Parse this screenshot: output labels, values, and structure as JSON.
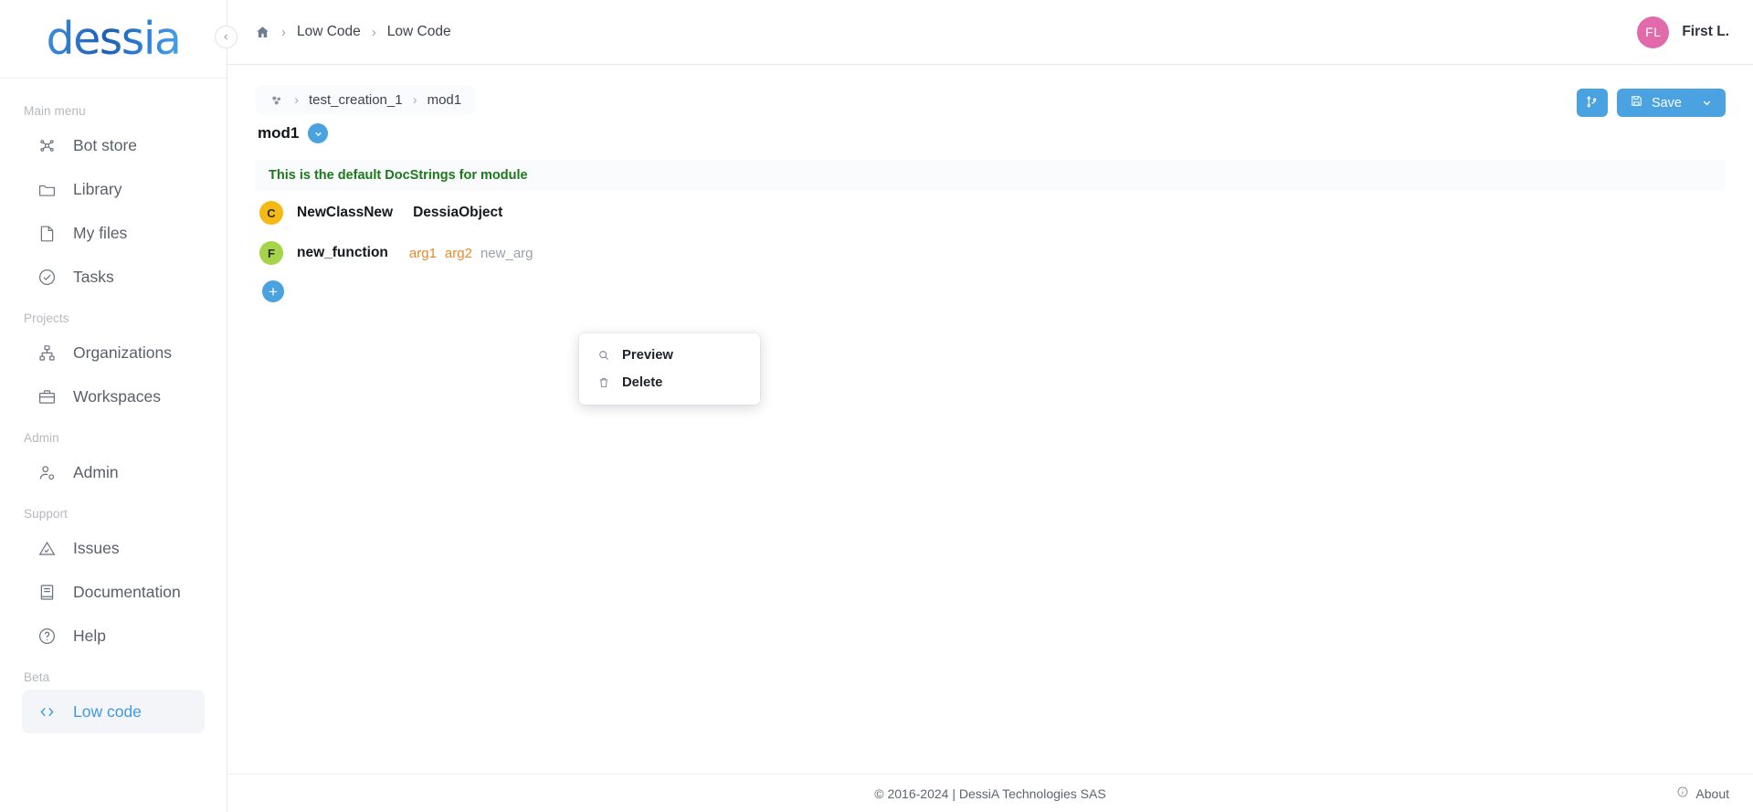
{
  "brand": {
    "logo_text": "dessia"
  },
  "sidebar": {
    "sections": [
      {
        "label": "Main menu",
        "items": [
          {
            "label": "Bot store",
            "icon": "bot-store-icon"
          },
          {
            "label": "Library",
            "icon": "folder-icon"
          },
          {
            "label": "My files",
            "icon": "file-icon"
          },
          {
            "label": "Tasks",
            "icon": "check-circle-icon"
          }
        ]
      },
      {
        "label": "Projects",
        "items": [
          {
            "label": "Organizations",
            "icon": "org-chart-icon"
          },
          {
            "label": "Workspaces",
            "icon": "briefcase-icon"
          }
        ]
      },
      {
        "label": "Admin",
        "items": [
          {
            "label": "Admin",
            "icon": "user-cog-icon"
          }
        ]
      },
      {
        "label": "Support",
        "items": [
          {
            "label": "Issues",
            "icon": "alert-triangle-icon"
          },
          {
            "label": "Documentation",
            "icon": "book-icon"
          },
          {
            "label": "Help",
            "icon": "question-circle-icon"
          }
        ]
      },
      {
        "label": "Beta",
        "items": [
          {
            "label": "Low code",
            "icon": "code-brackets-icon",
            "active": true
          }
        ]
      }
    ]
  },
  "topbar": {
    "home_icon": "home-icon",
    "breadcrumbs": [
      "Low Code",
      "Low Code"
    ],
    "separator": "›",
    "user": {
      "initials": "FL",
      "name": "First L.",
      "avatar_color": "#e06aaa"
    },
    "collapse_icon": "chevron-left-icon"
  },
  "module": {
    "mini_breadcrumbs": [
      "test_creation_1",
      "mod1"
    ],
    "cube_icon": "cube-icon",
    "title": "mod1",
    "expand_icon": "chevron-down-icon",
    "docstring": "This is the default DocStrings for module",
    "members": [
      {
        "badge": "C",
        "badge_kind": "cls",
        "name": "NewClassNew",
        "base": "DessiaObject",
        "args": []
      },
      {
        "badge": "F",
        "badge_kind": "fun",
        "name": "new_function",
        "base": "",
        "args": [
          {
            "text": "arg1",
            "kind": "typed"
          },
          {
            "text": "arg2",
            "kind": "typed"
          },
          {
            "text": "new_arg",
            "kind": "plain"
          }
        ]
      }
    ],
    "add_label": "+"
  },
  "actions": {
    "branch_icon": "git-branch-icon",
    "save_label": "Save",
    "save_icon": "floppy-disk-icon",
    "save_chevron_icon": "chevron-down-icon"
  },
  "context_menu": {
    "items": [
      {
        "label": "Preview",
        "icon": "magnifier-icon"
      },
      {
        "label": "Delete",
        "icon": "trash-icon"
      }
    ]
  },
  "footer": {
    "copyright": "© 2016-2024 | DessiA Technologies SAS",
    "about_label": "About",
    "about_icon": "info-circle-icon"
  },
  "colors": {
    "accent": "#4aa3e0",
    "docstring_green": "#1a7a1a",
    "class_badge": "#f5b916",
    "function_badge": "#a5d44a",
    "arg_typed": "#e8892a",
    "arg_plain": "#9aa1ac"
  }
}
